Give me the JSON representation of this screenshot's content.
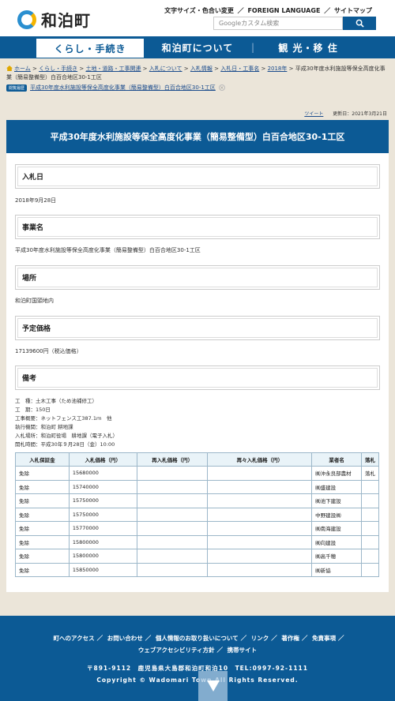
{
  "header": {
    "logo_text": "和泊町",
    "util_links": [
      "文字サイズ・色合い変更",
      "FOREIGN LANGUAGE",
      "サイトマップ"
    ],
    "search_placeholder": "Googleカスタム検索"
  },
  "nav": {
    "items": [
      "くらし・手続き",
      "和泊町について",
      "観 光・移 住"
    ]
  },
  "breadcrumb": {
    "items": [
      "ホーム",
      "くらし・手続き",
      "土地・道路・工事関連",
      "入札について",
      "入札情報",
      "入札日・工事名",
      "2018年"
    ],
    "current": "平成30年度水利施設等保全高度化事業（簡易整備型）白百合地区30-1工区"
  },
  "recent": {
    "badge": "閲覧履歴",
    "link": "平成30年度水利施設等保全高度化事業（簡易整備型）白百合地区30-1工区"
  },
  "tweet_label": "ツイート",
  "updated": "更新日：2021年3月21日",
  "page_title": "平成30年度水利施設等保全高度化事業（簡易整備型）白百合地区30-1工区",
  "sections": {
    "bid_date": {
      "heading": "入札日",
      "value": "2018年9月28日"
    },
    "project": {
      "heading": "事業名",
      "value": "平成30年度水利施設等保全高度化事業（簡易整備型）白百合地区30-1工区"
    },
    "place": {
      "heading": "場所",
      "value": "和泊町国頭地内"
    },
    "price": {
      "heading": "予定価格",
      "value": "17139600円（税込価格）"
    },
    "notes": {
      "heading": "備考",
      "lines": [
        "工　種：土木工事（ため池補修工）",
        "工　期：150日",
        "工事概要：ネットフェンス工387.1ｍ　他",
        "執行機関：和泊町 耕地課",
        "入札場所：和泊町役場　耕地課（電子入札）",
        "開札時間：平成30年９月28日（金）10:00"
      ]
    }
  },
  "table": {
    "headers": [
      "入札保証金",
      "入札価格（円）",
      "再入札価格（円）",
      "再々入札価格（円）",
      "業者名",
      "落札"
    ],
    "rows": [
      [
        "免除",
        "15680000",
        "",
        "",
        "㈱沖永良部農材",
        "落札"
      ],
      [
        "免除",
        "15740000",
        "",
        "",
        "㈱盛建設",
        ""
      ],
      [
        "免除",
        "15750000",
        "",
        "",
        "㈱池下建設",
        ""
      ],
      [
        "免除",
        "15750000",
        "",
        "",
        "中野建設㈱",
        ""
      ],
      [
        "免除",
        "15770000",
        "",
        "",
        "㈱南海建設",
        ""
      ],
      [
        "免除",
        "15800000",
        "",
        "",
        "㈱向建設",
        ""
      ],
      [
        "免除",
        "15800000",
        "",
        "",
        "㈱高千穂",
        ""
      ],
      [
        "免除",
        "15850000",
        "",
        "",
        "㈱新協",
        ""
      ]
    ]
  },
  "footer": {
    "links": [
      "町へのアクセス",
      "お問い合わせ",
      "個人情報のお取り扱いについて",
      "リンク",
      "著作権",
      "免責事項",
      "ウェブアクセシビリティ方針",
      "携帯サイト"
    ],
    "address": "〒891-9112　鹿児島県大島郡和泊町和泊10　TEL:0997-92-1111",
    "copyright": "Copyright © Wadomari Town All Rights Reserved."
  }
}
